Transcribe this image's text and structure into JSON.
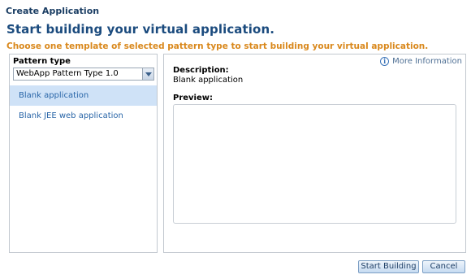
{
  "dialog": {
    "title": "Create Application",
    "heading": "Start building your virtual application.",
    "subheading": "Choose one template of selected pattern type to start building your virtual application."
  },
  "left_panel": {
    "pattern_type_label": "Pattern type",
    "pattern_type_selected": "WebApp Pattern Type 1.0",
    "templates": [
      {
        "label": "Blank application",
        "selected": true
      },
      {
        "label": "Blank JEE web application",
        "selected": false
      }
    ]
  },
  "right_panel": {
    "more_info_label": "More Information",
    "info_icon": "info-circle-icon",
    "description_label": "Description:",
    "description_value": "Blank application",
    "preview_label": "Preview:"
  },
  "buttons": {
    "start_label": "Start Building",
    "cancel_label": "Cancel"
  },
  "colors": {
    "heading": "#1b4b7e",
    "subheading": "#d9881c",
    "link": "#2a66a8",
    "selected_row": "#cfe2f7"
  }
}
